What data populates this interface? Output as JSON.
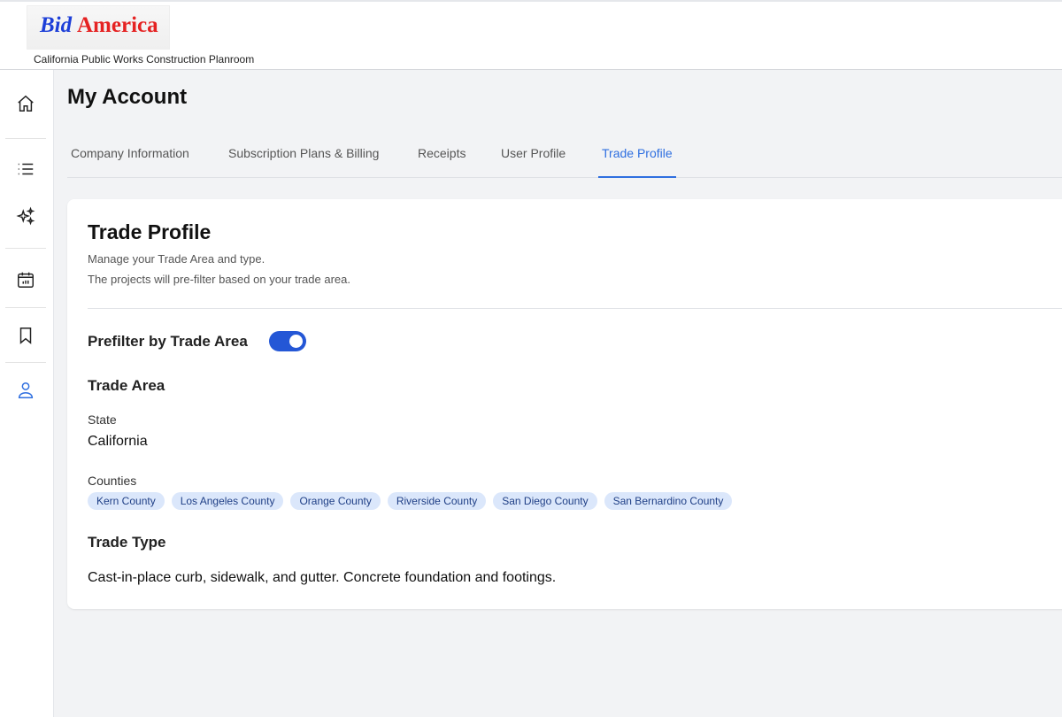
{
  "header": {
    "logo_bid": "Bid",
    "logo_america": "America",
    "tagline": "California Public Works Construction Planroom"
  },
  "sidebar": {
    "items": [
      {
        "icon": "home-icon"
      },
      {
        "icon": "list-icon"
      },
      {
        "icon": "sparkles-icon"
      },
      {
        "icon": "calendar-icon"
      },
      {
        "icon": "bookmark-icon"
      },
      {
        "icon": "user-icon",
        "active": true
      }
    ]
  },
  "page": {
    "title": "My Account"
  },
  "tabs": [
    {
      "label": "Company Information"
    },
    {
      "label": "Subscription Plans & Billing"
    },
    {
      "label": "Receipts"
    },
    {
      "label": "User Profile"
    },
    {
      "label": "Trade Profile",
      "active": true
    }
  ],
  "card": {
    "title": "Trade Profile",
    "desc1": "Manage your Trade Area and type.",
    "desc2": "The projects will pre-filter based on your trade area.",
    "prefilter_label": "Prefilter by Trade Area",
    "prefilter_on": true,
    "trade_area_heading": "Trade Area",
    "state_label": "State",
    "state_value": "California",
    "counties_label": "Counties",
    "counties": [
      "Kern County",
      "Los Angeles County",
      "Orange County",
      "Riverside County",
      "San Diego County",
      "San Bernardino County"
    ],
    "trade_type_heading": "Trade Type",
    "trade_type_value": "Cast-in-place curb, sidewalk, and gutter. Concrete foundation and footings."
  },
  "colors": {
    "accent": "#2f6fe0",
    "toggle": "#2457d6",
    "chip_bg": "#dbe7fb"
  }
}
